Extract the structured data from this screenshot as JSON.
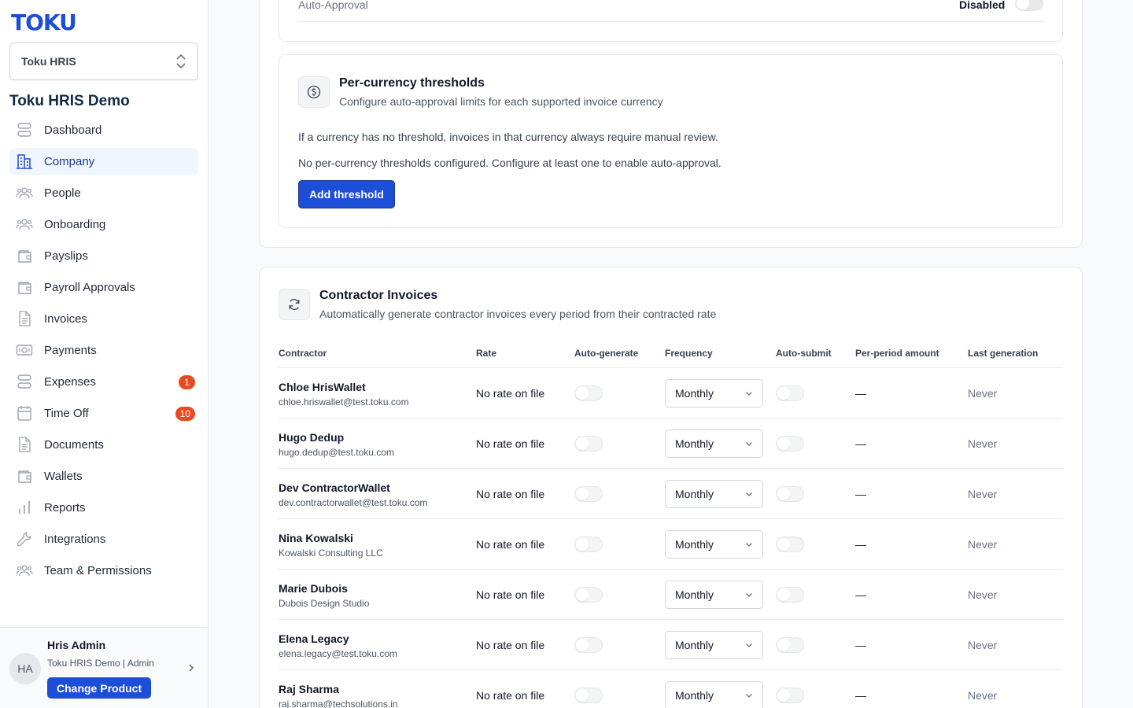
{
  "sidebar": {
    "logo": "TOKU",
    "product_select": "Toku HRIS",
    "org_name": "Toku HRIS Demo",
    "items": [
      {
        "label": "Dashboard",
        "icon": "stack-icon",
        "active": false
      },
      {
        "label": "Company",
        "icon": "building-icon",
        "active": true
      },
      {
        "label": "People",
        "icon": "people-icon",
        "active": false
      },
      {
        "label": "Onboarding",
        "icon": "people-icon",
        "active": false
      },
      {
        "label": "Payslips",
        "icon": "wallet-icon",
        "active": false
      },
      {
        "label": "Payroll Approvals",
        "icon": "wallet-icon",
        "active": false
      },
      {
        "label": "Invoices",
        "icon": "document-icon",
        "active": false
      },
      {
        "label": "Payments",
        "icon": "banknote-icon",
        "active": false
      },
      {
        "label": "Expenses",
        "icon": "stack-icon",
        "active": false,
        "badge": "1"
      },
      {
        "label": "Time Off",
        "icon": "calendar-icon",
        "active": false,
        "badge": "10"
      },
      {
        "label": "Documents",
        "icon": "document-icon",
        "active": false
      },
      {
        "label": "Wallets",
        "icon": "wallet-icon",
        "active": false
      },
      {
        "label": "Reports",
        "icon": "bar-chart-icon",
        "active": false
      },
      {
        "label": "Integrations",
        "icon": "wrench-icon",
        "active": false
      },
      {
        "label": "Team & Permissions",
        "icon": "people-icon",
        "active": false
      }
    ],
    "user": {
      "initials": "HA",
      "name": "Hris Admin",
      "role": "Toku HRIS Demo | Admin",
      "change_label": "Change Product"
    }
  },
  "auto_approval": {
    "label": "Auto-Approval",
    "status": "Disabled",
    "enabled": false
  },
  "per_currency": {
    "title": "Per-currency thresholds",
    "subtitle": "Configure auto-approval limits for each supported invoice currency",
    "note": "If a currency has no threshold, invoices in that currency always require manual review.",
    "empty": "No per-currency thresholds configured. Configure at least one to enable auto-approval.",
    "add_label": "Add threshold"
  },
  "contractor_invoices": {
    "title": "Contractor Invoices",
    "subtitle": "Automatically generate contractor invoices every period from their contracted rate",
    "columns": [
      "Contractor",
      "Rate",
      "Auto-generate",
      "Frequency",
      "Auto-submit",
      "Per-period amount",
      "Last generation"
    ],
    "rows": [
      {
        "name": "Chloe HrisWallet",
        "sub": "chloe.hriswallet@test.toku.com",
        "rate": "No rate on file",
        "frequency": "Monthly",
        "amount": "—",
        "last": "Never"
      },
      {
        "name": "Hugo Dedup",
        "sub": "hugo.dedup@test.toku.com",
        "rate": "No rate on file",
        "frequency": "Monthly",
        "amount": "—",
        "last": "Never"
      },
      {
        "name": "Dev ContractorWallet",
        "sub": "dev.contractorwallet@test.toku.com",
        "rate": "No rate on file",
        "frequency": "Monthly",
        "amount": "—",
        "last": "Never"
      },
      {
        "name": "Nina Kowalski",
        "sub": "Kowalski Consulting LLC",
        "rate": "No rate on file",
        "frequency": "Monthly",
        "amount": "—",
        "last": "Never"
      },
      {
        "name": "Marie Dubois",
        "sub": "Dubois Design Studio",
        "rate": "No rate on file",
        "frequency": "Monthly",
        "amount": "—",
        "last": "Never"
      },
      {
        "name": "Elena Legacy",
        "sub": "elena.legacy@test.toku.com",
        "rate": "No rate on file",
        "frequency": "Monthly",
        "amount": "—",
        "last": "Never"
      },
      {
        "name": "Raj Sharma",
        "sub": "raj.sharma@techsolutions.in",
        "rate": "No rate on file",
        "frequency": "Monthly",
        "amount": "—",
        "last": "Never"
      }
    ]
  },
  "colors": {
    "brand": "#1d4ed8",
    "badge": "#ea4a1f",
    "active_bg": "#eff6ff"
  }
}
